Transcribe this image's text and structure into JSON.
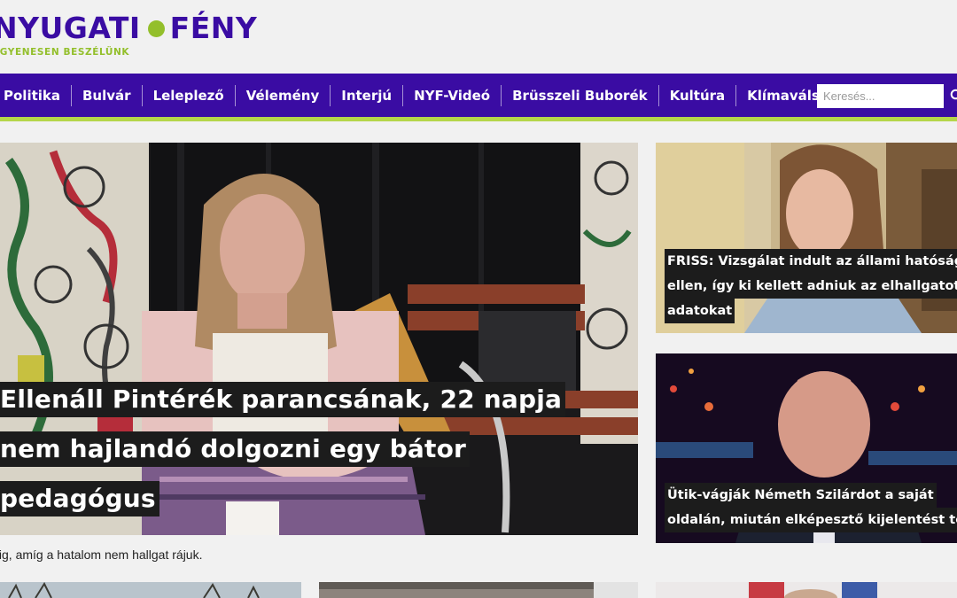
{
  "site": {
    "logo_left": "NYUGATI",
    "logo_right": "FÉNY",
    "tagline": "EGYENESEN BESZÉLÜNK",
    "brand_color": "#3a0ca3",
    "accent_color": "#93bf2b"
  },
  "nav": {
    "items": [
      {
        "label": "Politika"
      },
      {
        "label": "Bulvár"
      },
      {
        "label": "Leleplező"
      },
      {
        "label": "Vélemény"
      },
      {
        "label": "Interjú"
      },
      {
        "label": "NYF-Videó"
      },
      {
        "label": "Brüsszeli Buborék"
      },
      {
        "label": "Kultúra"
      },
      {
        "label": "Klímaválság"
      }
    ],
    "search_placeholder": "Keresés...",
    "search_icon": "search-icon"
  },
  "hero": {
    "title_lines": [
      "Ellenáll Pintérék parancsának, 22 napja",
      "nem hajlandó dolgozni egy bátor",
      "pedagógus"
    ],
    "teaser": "Addig, amíg a hatalom nem hallgat rájuk."
  },
  "side_articles": [
    {
      "title_lines": [
        "FRISS: Vizsgálat indult az állami hatóság",
        "ellen, így ki kellett adniuk az elhallgatott",
        "adatokat"
      ]
    },
    {
      "title_lines": [
        "Ütik-vágják Németh Szilárdot a saját",
        "oldalán, miután elképesztő kijelentést tett"
      ]
    }
  ]
}
